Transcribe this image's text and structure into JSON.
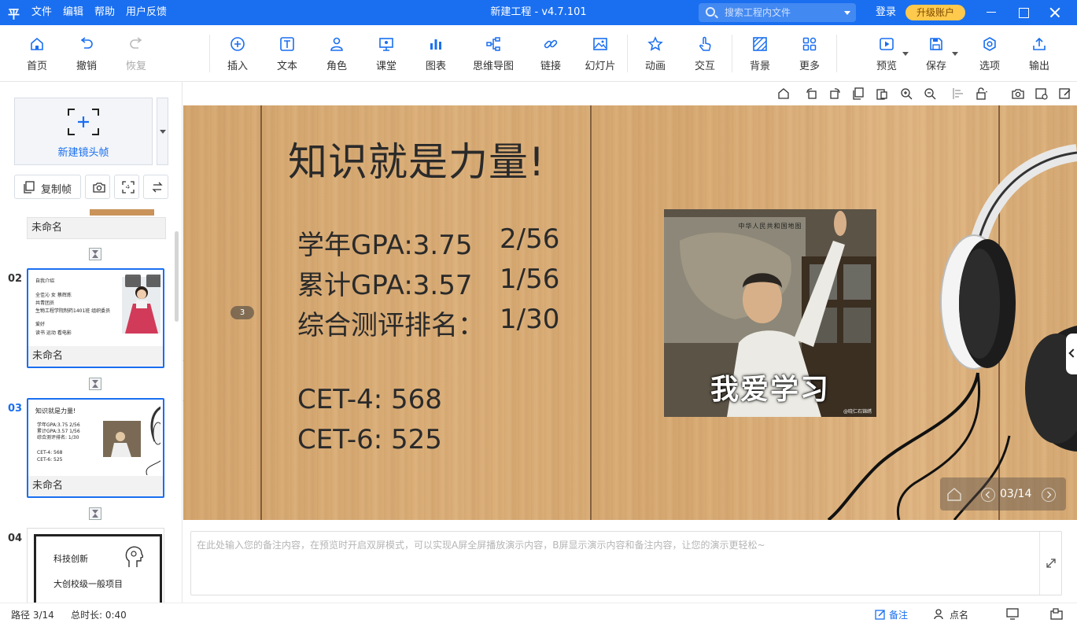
{
  "app": {
    "logo": "平",
    "menu": [
      "文件",
      "编辑",
      "帮助",
      "用户反馈"
    ],
    "title": "新建工程 - v4.7.101",
    "search_placeholder": "搜索工程内文件",
    "login": "登录",
    "upgrade": "升级账户"
  },
  "toolbar": {
    "home": "首页",
    "undo": "撤销",
    "redo": "恢复",
    "insert": "插入",
    "text": "文本",
    "role": "角色",
    "class": "课堂",
    "chart": "图表",
    "mindmap": "思维导图",
    "link": "链接",
    "slide": "幻灯片",
    "animation": "动画",
    "interact": "交互",
    "background": "背景",
    "more": "更多",
    "preview": "预览",
    "save": "保存",
    "options": "选项",
    "export": "输出"
  },
  "left_panel": {
    "new_frame": "新建镜头帧",
    "copy_frame": "复制帧",
    "slides": [
      {
        "num": "",
        "name": "未命名"
      },
      {
        "num": "02",
        "name": "未命名",
        "lines": [
          "自我介绍",
          "全佳沁   女   蔡辉炼",
          "共青团员",
          "生物工程学院制药1401班  组织委员",
          "爱好",
          "读书 运动 看电影"
        ]
      },
      {
        "num": "03",
        "name": "未命名",
        "lines": [
          "知识就是力量!",
          "学年GPA:3.75     2/56",
          "累计GPA:3.57      1/56",
          "综合测评排名:      1/30",
          "CET-4: 568",
          "CET-6: 525"
        ]
      },
      {
        "num": "04",
        "lines": [
          "科技创新",
          "大创校级一般项目"
        ]
      }
    ]
  },
  "canvas": {
    "title": "知识就是力量!",
    "stats": [
      {
        "label": "学年GPA:3.75",
        "value": "2/56"
      },
      {
        "label": "累计GPA:3.57",
        "value": "1/56"
      },
      {
        "label": "综合测评排名：",
        "value": "1/30"
      }
    ],
    "cet4": "CET-4: 568",
    "cet6": "CET-6: 525",
    "photo_caption": "我爱学习",
    "photo_map_text": "中华人民共和国地图",
    "photo_watermark": "@晓仁石锦绣",
    "step_badge": "3",
    "pager": "03/14"
  },
  "notes": {
    "placeholder": "在此处输入您的备注内容，在预览时开启双屏模式，可以实现A屏全屏播放演示内容，B屏显示演示内容和备注内容，让您的演示更轻松~"
  },
  "status": {
    "path": "路径 3/14",
    "duration": "总时长: 0:40",
    "notes": "备注",
    "roll_call": "点名"
  },
  "colors": {
    "brand": "#1a6ff0",
    "upgrade": "#ffc94d",
    "wood": "#d9ab74"
  }
}
